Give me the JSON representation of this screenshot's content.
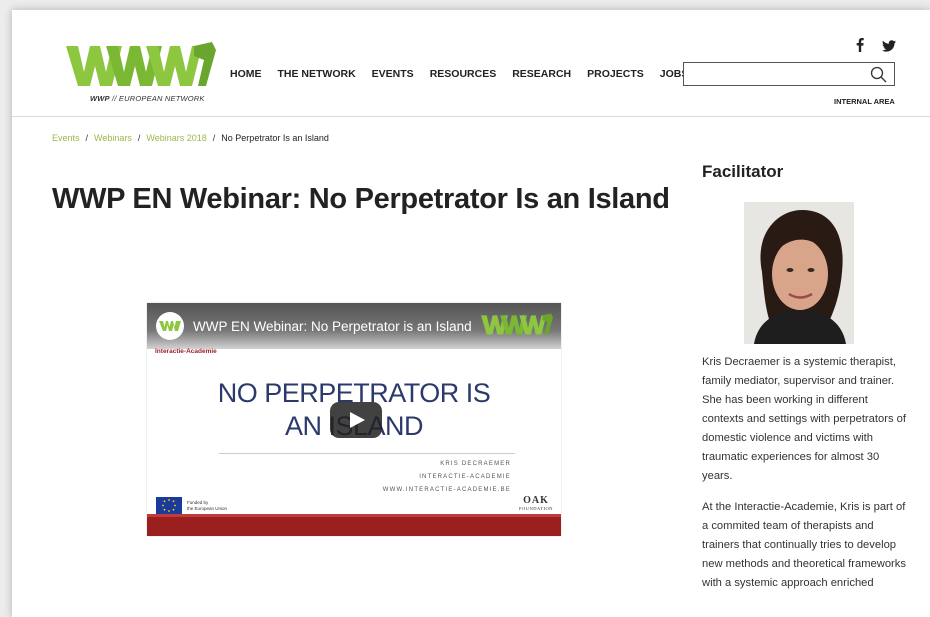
{
  "header": {
    "logo_subtitle_bold": "WWP",
    "logo_subtitle_rest": " // EUROPEAN NETWORK",
    "nav": [
      "HOME",
      "THE NETWORK",
      "EVENTS",
      "RESOURCES",
      "RESEARCH",
      "PROJECTS",
      "JOBS"
    ],
    "search": {
      "value": "",
      "placeholder": ""
    },
    "internal_area": "INTERNAL AREA",
    "social": [
      "facebook-icon",
      "twitter-icon"
    ]
  },
  "breadcrumb": {
    "items": [
      "Events",
      "Webinars",
      "Webinars 2018"
    ],
    "separator": "/",
    "current": "No Perpetrator Is an Island"
  },
  "page": {
    "title": "WWP EN Webinar: No Perpetrator Is an Island"
  },
  "video": {
    "title": "WWP EN Webinar: No Perpetrator is an Island",
    "channel_avatar_text": "WWP",
    "org_label": "Interactie-Academie",
    "slide_title_line1": "NO PERPETRATOR IS",
    "slide_title_line2": "AN ISLAND",
    "slide_author": "KRIS DECRAEMER",
    "slide_org": "INTERACTIE-ACADEMIE",
    "slide_url": "WWW.INTERACTIE-ACADEMIE.BE",
    "eu_line1": "Funded by",
    "eu_line2": "the European Union",
    "oak_big": "OAK",
    "oak_small": "FOUNDATION"
  },
  "sidebar": {
    "heading": "Facilitator",
    "bio_paragraph_1": "Kris Decraemer is a systemic therapist, family mediator, supervisor and trainer. She has been working in different contexts and settings with perpetrators of domestic violence and victims with traumatic experiences for almost 30 years.",
    "bio_paragraph_2": "At the Interactie-Academie, Kris is part of a commited team of therapists and trainers that continually tries to develop new methods and theoretical frameworks with a systemic approach enriched"
  },
  "colors": {
    "logo_green": "#8dc63f",
    "breadcrumb_green": "#9ab94d",
    "video_footer_red": "#9c1f1f",
    "slide_text_navy": "#2b3a6b"
  }
}
